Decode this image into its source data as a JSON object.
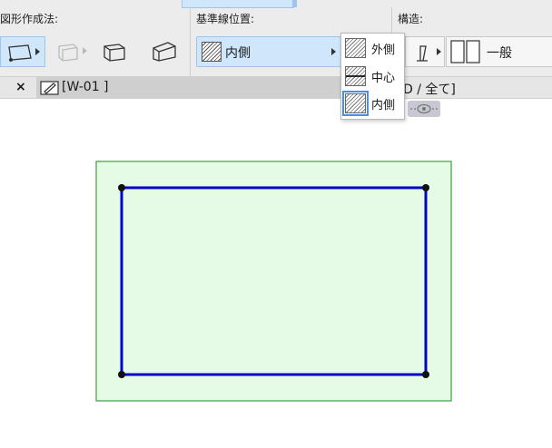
{
  "toolbar": {
    "geometry_method_label": "図形作成法:",
    "reference_line_label": "基準線位置:",
    "reference_line_value": "内側",
    "structure_label": "構造:",
    "structure_value": "一般"
  },
  "dropdown": {
    "options": [
      {
        "label": "外側",
        "selected": false
      },
      {
        "label": "中心",
        "selected": false
      },
      {
        "label": "内側",
        "selected": true
      }
    ]
  },
  "tabs": {
    "close_symbol": "×",
    "active_label": "[W-01 ]",
    "right_label": "D / 全て]"
  },
  "colors": {
    "wall_fill": "#e6fbe6",
    "wall_border": "#4aa84a",
    "reference_line": "#0000c8",
    "accent": "#cfe6fb"
  }
}
